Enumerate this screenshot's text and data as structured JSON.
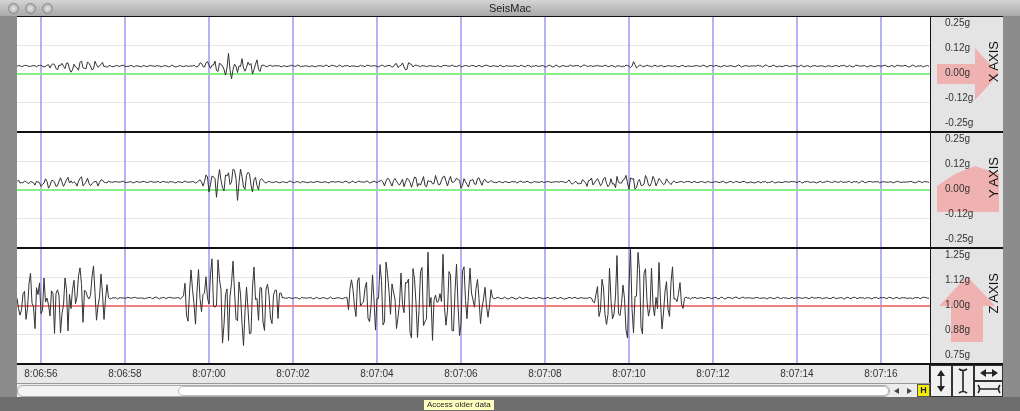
{
  "window": {
    "title": "SeisMac"
  },
  "panels": [
    {
      "axis_label": "X AXIS",
      "ticks": [
        "0.25g",
        "0.12g",
        "0.00g",
        "-0.12g",
        "-0.25g"
      ],
      "kind": "right",
      "color": "#88ee88"
    },
    {
      "axis_label": "Y AXIS",
      "ticks": [
        "0.25g",
        "0.12g",
        "0.00g",
        "-0.12g",
        "-0.25g"
      ],
      "kind": "wide",
      "color": "#88ee88"
    },
    {
      "axis_label": "Z AXIS",
      "ticks": [
        "1.25g",
        "1.12g",
        "1.00g",
        "0.88g",
        "0.75g"
      ],
      "kind": "up",
      "color": "#f08080"
    }
  ],
  "time_labels": [
    "8:06:56",
    "8:06:58",
    "8:07:00",
    "8:07:02",
    "8:07:04",
    "8:07:06",
    "8:07:08",
    "8:07:10",
    "8:07:12",
    "8:07:14",
    "8:07:16"
  ],
  "history_button": {
    "label": "H"
  },
  "tooltip": "Access older data"
}
